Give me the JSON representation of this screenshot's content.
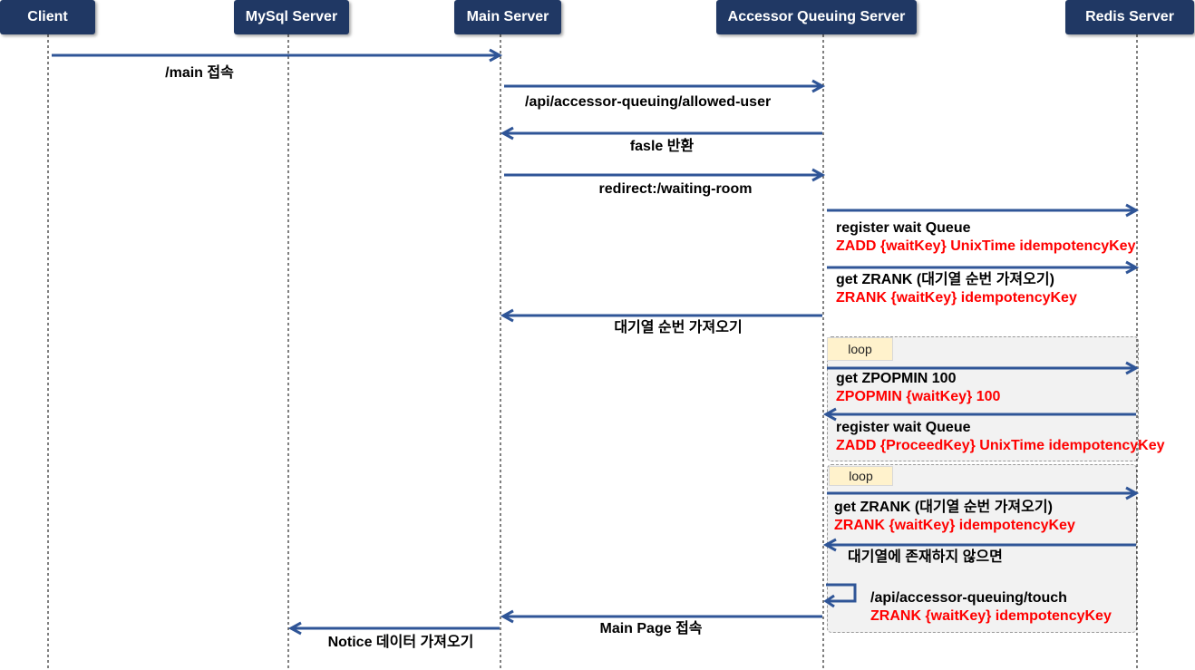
{
  "actors": [
    {
      "id": "client",
      "label": "Client"
    },
    {
      "id": "mysql",
      "label": "MySql Server"
    },
    {
      "id": "main",
      "label": "Main Server"
    },
    {
      "id": "accessor",
      "label": "Accessor Queuing Server"
    },
    {
      "id": "redis",
      "label": "Redis Server"
    }
  ],
  "loops": [
    {
      "label": "loop"
    },
    {
      "label": "loop"
    }
  ],
  "messages": [
    {
      "from": "client",
      "to": "main",
      "text": "/main 접속"
    },
    {
      "from": "main",
      "to": "accessor",
      "text": "/api/accessor-queuing/allowed-user"
    },
    {
      "from": "accessor",
      "to": "main",
      "text": "fasle 반환"
    },
    {
      "from": "main",
      "to": "accessor",
      "text": "redirect:/waiting-room"
    },
    {
      "from": "accessor",
      "to": "redis",
      "text": "register wait Queue",
      "command": "ZADD {waitKey} UnixTime idempotencyKey"
    },
    {
      "from": "accessor",
      "to": "redis",
      "text": "get ZRANK (대기열 순번 가져오기)",
      "command": "ZRANK {waitKey} idempotencyKey"
    },
    {
      "from": "accessor",
      "to": "main",
      "text": "대기열 순번 가져오기"
    },
    {
      "from": "accessor",
      "to": "redis",
      "text": "get ZPOPMIN 100",
      "command": "ZPOPMIN {waitKey} 100"
    },
    {
      "from": "redis",
      "to": "accessor",
      "text": "register wait Queue",
      "command": "ZADD {ProceedKey} UnixTime idempotencyKey"
    },
    {
      "from": "accessor",
      "to": "redis",
      "text": "get ZRANK (대기열 순번 가져오기)",
      "command": "ZRANK {waitKey} idempotencyKey"
    },
    {
      "from": "redis",
      "to": "accessor",
      "text": "대기열에 존재하지 않으면"
    },
    {
      "from": "accessor",
      "to": "accessor",
      "text": "/api/accessor-queuing/touch",
      "command": "ZRANK {waitKey} idempotencyKey"
    },
    {
      "from": "accessor",
      "to": "main",
      "text": "Main Page 접속"
    },
    {
      "from": "main",
      "to": "mysql",
      "text": "Notice 데이터 가져오기"
    }
  ],
  "colors": {
    "actor": "#203864",
    "arrow": "#2f5597",
    "command": "#ff0000",
    "loop_tag": "#fff2cc"
  }
}
